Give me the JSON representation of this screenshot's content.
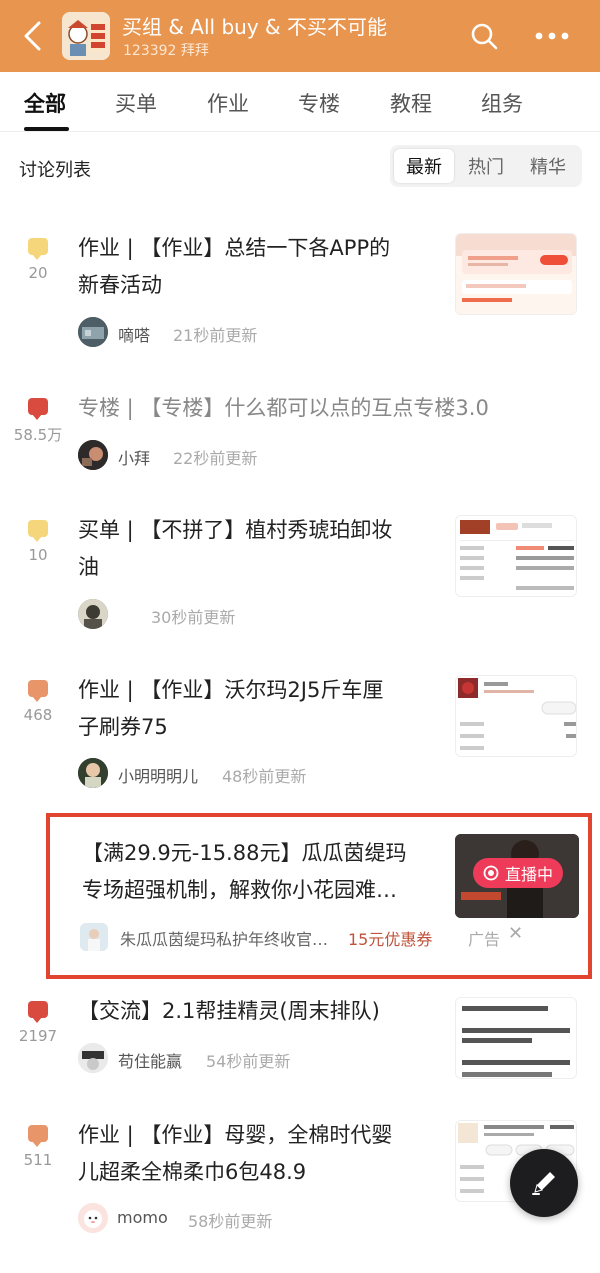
{
  "header": {
    "title": "买组 & All buy & 不买不可能",
    "subtitle": "123392 拜拜",
    "accent": "#E8954F"
  },
  "tabs": [
    {
      "label": "全部",
      "active": true
    },
    {
      "label": "买单"
    },
    {
      "label": "作业"
    },
    {
      "label": "专楼"
    },
    {
      "label": "教程"
    },
    {
      "label": "组务"
    }
  ],
  "discussion": {
    "title": "讨论列表",
    "sort": [
      "最新",
      "热门",
      "精华"
    ],
    "sort_active": "最新"
  },
  "posts": [
    {
      "count": "20",
      "bubble_color": "#F5D67A",
      "title_line1": "作业 | 【作业】总结一下各APP的",
      "title_line2": "新春活动",
      "author": "嘀嗒",
      "time": "21秒前更新"
    },
    {
      "count": "58.5万",
      "bubble_color": "#D94B3E",
      "title_line1": "专楼 | 【专楼】什么都可以点的互点专楼3.0",
      "author": "小拜",
      "time": "22秒前更新"
    },
    {
      "count": "10",
      "bubble_color": "#F5D67A",
      "title_line1": "买单 | 【不拼了】植村秀琥珀卸妆",
      "title_line2": "油",
      "author": "",
      "time": "30秒前更新"
    },
    {
      "count": "468",
      "bubble_color": "#E8956A",
      "title_line1": "作业 | 【作业】沃尔玛2J5斤车厘",
      "title_line2": "子刷券75",
      "author": "小明明明儿",
      "time": "48秒前更新"
    },
    {
      "count": "2197",
      "bubble_color": "#D94B3E",
      "title_line1": "【交流】2.1帮挂精灵(周末排队)",
      "author": "苟住能赢",
      "time": "54秒前更新"
    },
    {
      "count": "511",
      "bubble_color": "#E8956A",
      "title_line1": "作业 | 【作业】母婴，全棉时代婴",
      "title_line2": "儿超柔全棉柔巾6包48.9",
      "author": "momo",
      "time": "58秒前更新"
    }
  ],
  "ad": {
    "title_line1": "【满29.9元-15.88元】瓜瓜茵缇玛",
    "title_line2": "专场超强机制，解救你小花园难…",
    "author": "朱瓜瓜茵缇玛私护年终收官…",
    "coupon": "15元优惠券",
    "label": "广告",
    "close": "✕",
    "live_badge": "直播中",
    "box_color": "#E2452F"
  },
  "icons": {
    "back": "back-chevron-icon",
    "search": "search-icon",
    "more": "more-dots-icon",
    "compose": "pencil-icon"
  }
}
